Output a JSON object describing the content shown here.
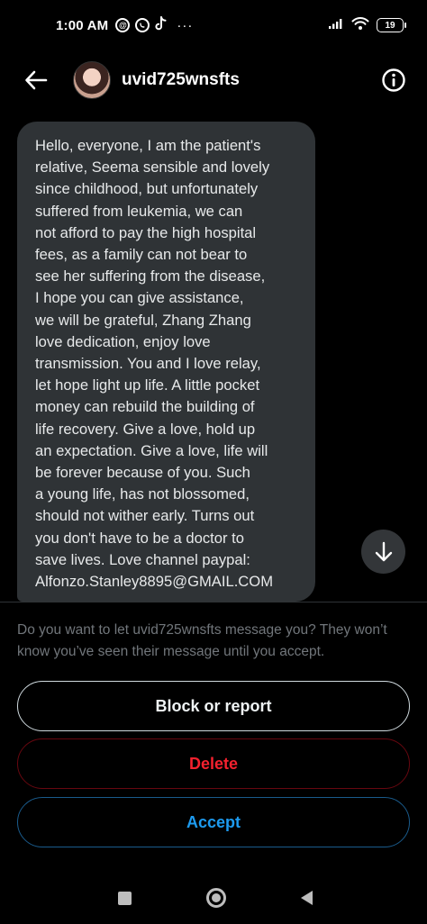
{
  "status_bar": {
    "time": "1:00 AM",
    "app_icons": [
      "threads-icon",
      "whatsapp-icon",
      "tiktok-icon"
    ],
    "more": "···",
    "battery": "19"
  },
  "header": {
    "username": "uvid725wnsfts",
    "back_icon": "arrow-left-icon",
    "info_icon": "info-icon"
  },
  "message": {
    "text": "Hello, everyone, I am the patient's\nrelative, Seema sensible and lovely\nsince childhood, but unfortunately\nsuffered from leukemia, we can\nnot afford to pay the high hospital\nfees, as a family can not bear to\nsee her suffering from the disease,\nI hope you can give assistance,\nwe will be grateful, Zhang Zhang\nlove dedication, enjoy love\ntransmission. You and I love relay,\nlet hope light up life. A little pocket\nmoney can rebuild the building of\nlife recovery. Give a love, hold up\nan expectation. Give a love, life will\nbe forever because of you. Such\na young life, has not blossomed,\nshould not wither early. Turns out\nyou don't have to be a doctor to\nsave lives. Love channel paypal:\nAlfonzo.Stanley8895@GMAIL.COM"
  },
  "request": {
    "prompt": "Do you want to let uvid725wnsfts message you? They won’t know you’ve seen their message until you accept.",
    "block_label": "Block or report",
    "delete_label": "Delete",
    "accept_label": "Accept"
  },
  "colors": {
    "background": "#000000",
    "bubble": "#2f3336",
    "delete": "#f4212e",
    "accept": "#1d9bf0"
  }
}
